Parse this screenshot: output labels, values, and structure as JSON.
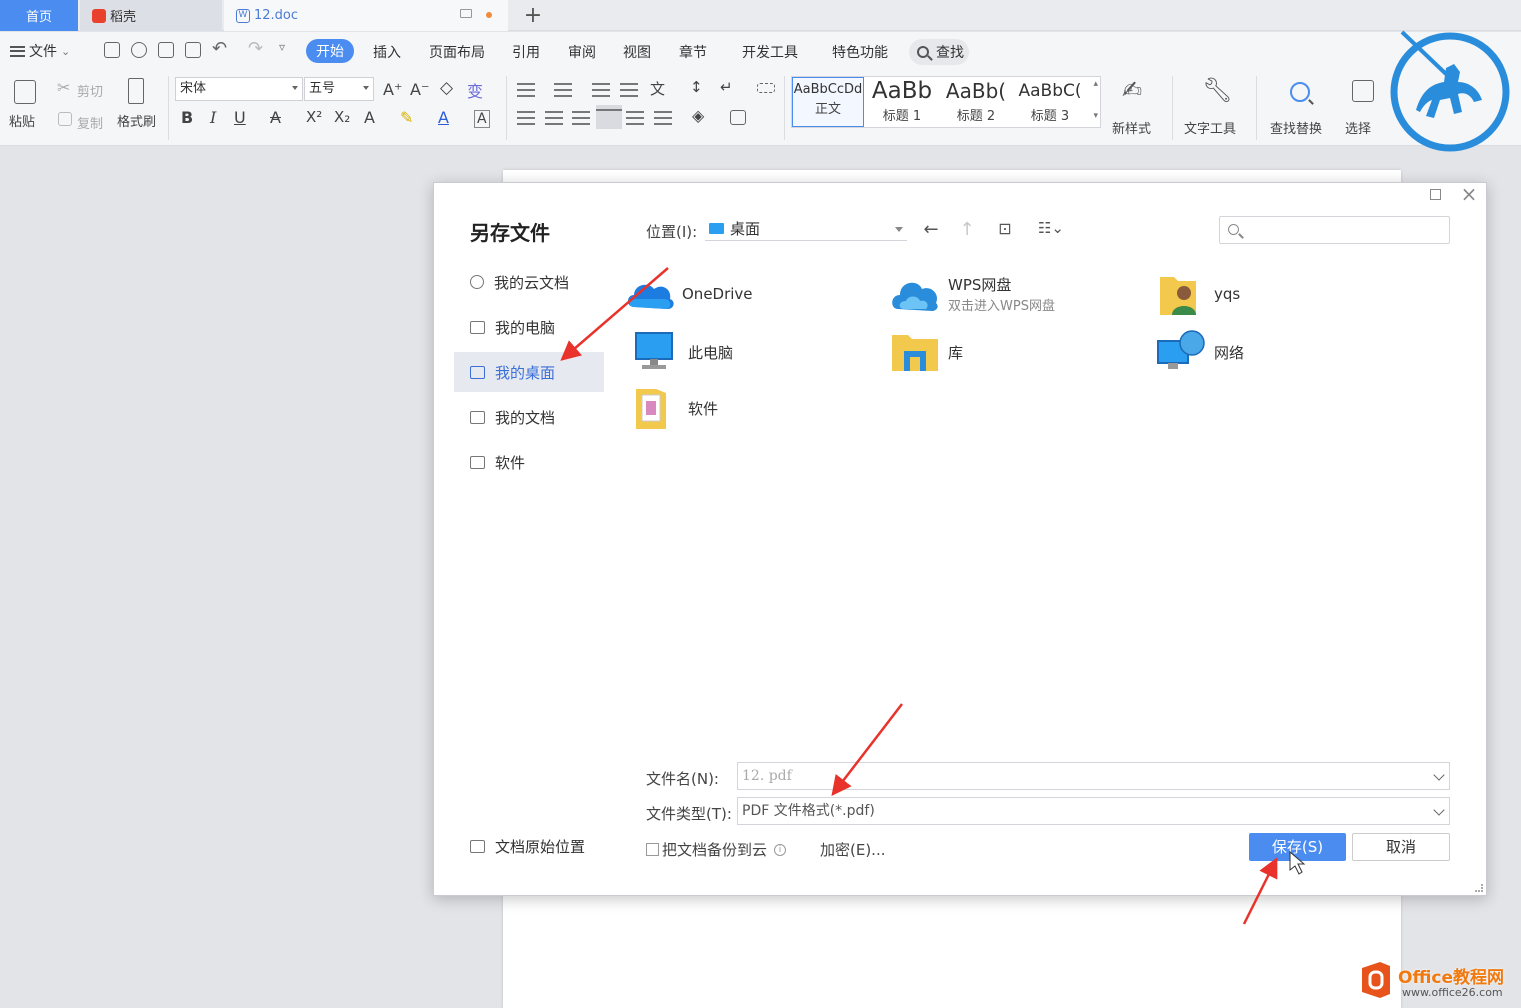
{
  "tabs": {
    "home": "首页",
    "daoke": "稻壳",
    "doc": "12.doc",
    "add": "+"
  },
  "menu": {
    "file": "文件",
    "items": [
      "开始",
      "插入",
      "页面布局",
      "引用",
      "审阅",
      "视图",
      "章节",
      "开发工具",
      "特色功能"
    ],
    "search": "查找"
  },
  "ribbon": {
    "paste": "粘贴",
    "cut": "剪切",
    "copy": "复制",
    "format_painter": "格式刷",
    "font_name": "宋体",
    "font_size": "五号",
    "styles": [
      {
        "sample": "AaBbCcDd",
        "name": "正文"
      },
      {
        "sample": "AaBb",
        "name": "标题 1"
      },
      {
        "sample": "AaBb(",
        "name": "标题 2"
      },
      {
        "sample": "AaBbC(",
        "name": "标题 3"
      }
    ],
    "new_style": "新样式",
    "text_tools": "文字工具",
    "find_replace": "查找替换",
    "select": "选择"
  },
  "dialog": {
    "title": "另存文件",
    "nav": [
      "我的云文档",
      "我的电脑",
      "我的桌面",
      "我的文档",
      "软件"
    ],
    "active_nav": 2,
    "location_label": "位置(I):",
    "location_value": "桌面",
    "files": [
      {
        "name": "OneDrive",
        "sub": ""
      },
      {
        "name": "WPS网盘",
        "sub": "双击进入WPS网盘"
      },
      {
        "name": "yqs",
        "sub": ""
      },
      {
        "name": "此电脑",
        "sub": ""
      },
      {
        "name": "库",
        "sub": ""
      },
      {
        "name": "网络",
        "sub": ""
      },
      {
        "name": "软件",
        "sub": ""
      }
    ],
    "filename_label": "文件名(N):",
    "filename_value": "12. pdf",
    "filetype_label": "文件类型(T):",
    "filetype_value": "PDF 文件格式(*.pdf)",
    "backup_label": "把文档备份到云",
    "encrypt_label": "加密(E)...",
    "orig_location": "文档原始位置",
    "save_button": "保存(S)",
    "cancel_button": "取消"
  },
  "watermark": {
    "site_name": "Office教程网",
    "site_url": "www.office26.com"
  },
  "colors": {
    "accent": "#4b8cf0",
    "annotation_arrow": "#e8322b"
  }
}
